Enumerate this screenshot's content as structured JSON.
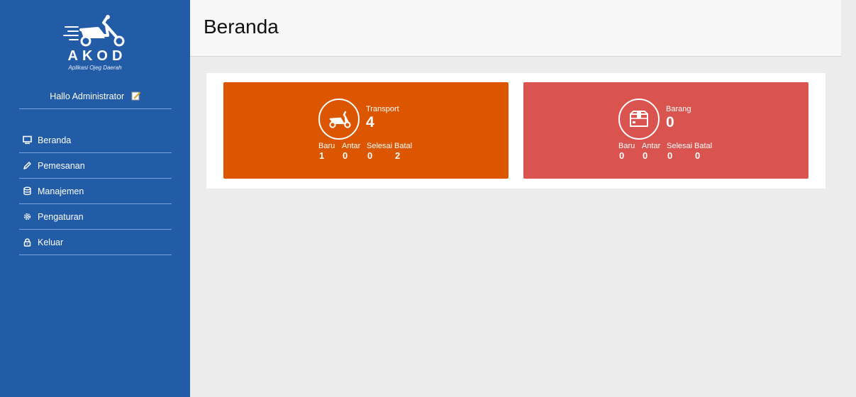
{
  "app": {
    "logo_title": "AKOD",
    "logo_subtitle": "Aplikasi Ojeg Daerah",
    "greeting": "Hallo Administrator"
  },
  "sidebar": {
    "items": [
      {
        "label": "Beranda",
        "icon": "monitor-icon"
      },
      {
        "label": "Pemesanan",
        "icon": "pencil-icon"
      },
      {
        "label": "Manajemen",
        "icon": "database-icon"
      },
      {
        "label": "Pengaturan",
        "icon": "gear-icon"
      },
      {
        "label": "Keluar",
        "icon": "lock-icon"
      }
    ]
  },
  "header": {
    "title": "Beranda"
  },
  "cards": [
    {
      "label": "Transport",
      "value": "4",
      "icon": "scooter-icon",
      "color": "#dc5600",
      "stats": [
        {
          "label": "Baru",
          "value": "1"
        },
        {
          "label": "Antar",
          "value": "0"
        },
        {
          "label": "Selesai",
          "value": "0"
        },
        {
          "label": "Batal",
          "value": "2"
        }
      ]
    },
    {
      "label": "Barang",
      "value": "0",
      "icon": "box-icon",
      "color": "#d9534f",
      "stats": [
        {
          "label": "Baru",
          "value": "0"
        },
        {
          "label": "Antar",
          "value": "0"
        },
        {
          "label": "Selesai",
          "value": "0"
        },
        {
          "label": "Batal",
          "value": "0"
        }
      ]
    }
  ],
  "colors": {
    "sidebar": "#225ca7",
    "transport": "#dc5600",
    "barang": "#d9534f"
  }
}
